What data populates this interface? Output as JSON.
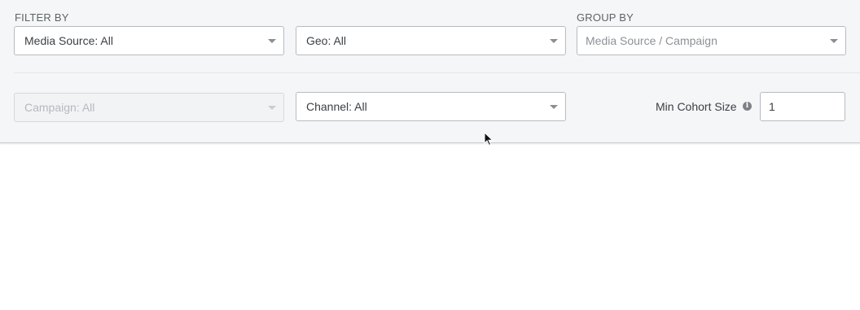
{
  "filter_by": {
    "label": "FILTER BY",
    "media_source": "Media Source: All",
    "geo": "Geo: All",
    "campaign": "Campaign: All",
    "channel": "Channel: All"
  },
  "group_by": {
    "label": "GROUP BY",
    "placeholder": "Media Source / Campaign"
  },
  "min_cohort": {
    "label": "Min Cohort Size",
    "value": "1",
    "info_icon": "info-icon"
  },
  "icons": {
    "dropdown": "chevron-down-icon",
    "pointer": "mouse-cursor-icon"
  }
}
